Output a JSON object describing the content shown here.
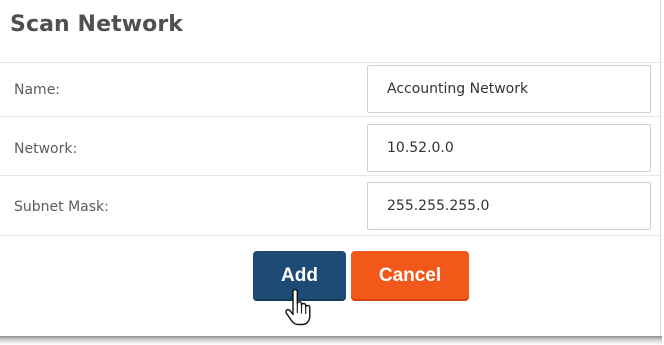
{
  "dialog": {
    "title": "Scan Network"
  },
  "form": {
    "fields": [
      {
        "label": "Name:",
        "value": "Accounting Network"
      },
      {
        "label": "Network:",
        "value": "10.52.0.0"
      },
      {
        "label": "Subnet Mask:",
        "value": "255.255.255.0"
      }
    ]
  },
  "actions": {
    "add_label": "Add",
    "cancel_label": "Cancel"
  },
  "colors": {
    "add_button": "#1e4b76",
    "cancel_button": "#f2581a",
    "title_text": "#505050",
    "label_text": "#5c5c5c"
  },
  "icons": {
    "cursor": "hand-pointer-icon"
  }
}
